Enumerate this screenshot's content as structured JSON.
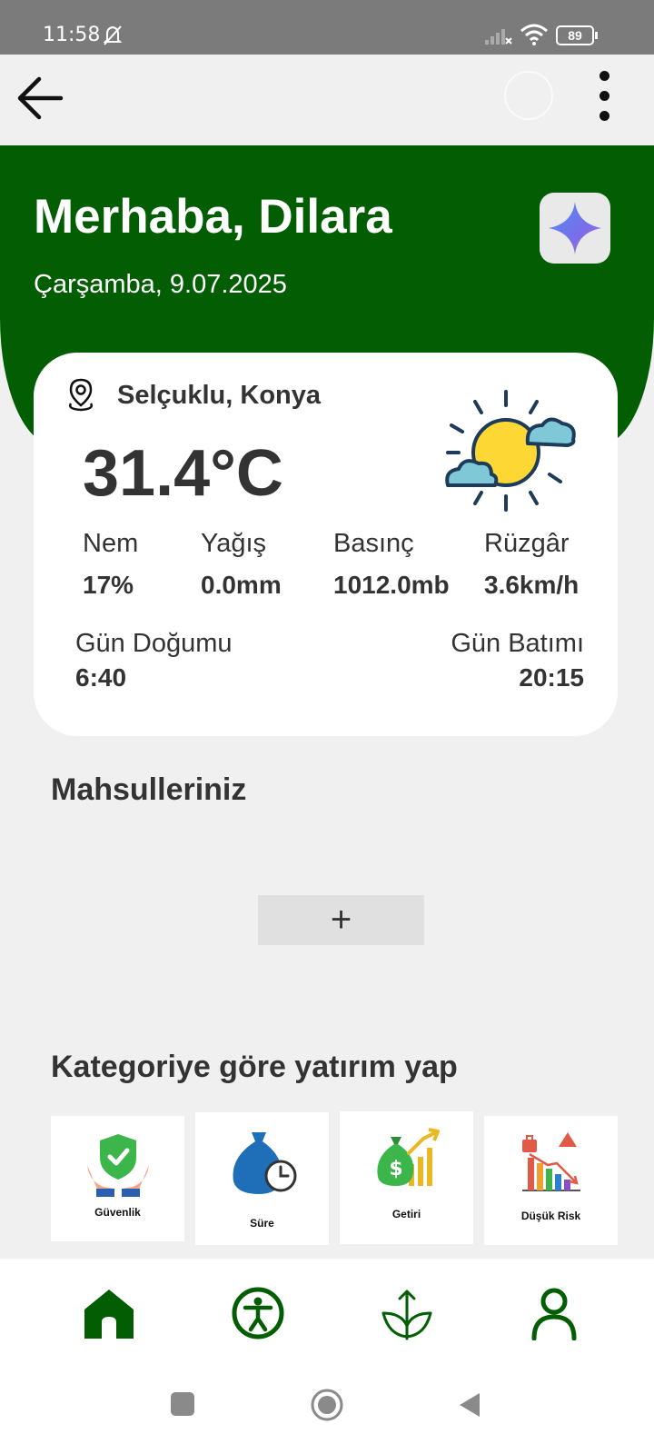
{
  "status_bar": {
    "time": "11:58",
    "battery": "89",
    "icons": [
      "bell-muted-icon",
      "signal-icon",
      "wifi-icon",
      "battery-icon"
    ]
  },
  "app_bar": {
    "back_icon": "arrow-left-icon",
    "menu_icon": "more-vert-icon"
  },
  "header": {
    "greeting": "Merhaba, Dilara",
    "date": "Çarşamba, 9.07.2025",
    "ai_icon": "sparkle-icon"
  },
  "weather": {
    "location": "Selçuklu, Konya",
    "temperature": "31.4°C",
    "condition_icon": "sun-cloud-icon",
    "stats": [
      {
        "label": "Nem",
        "value": "17%"
      },
      {
        "label": "Yağış",
        "value": "0.0mm"
      },
      {
        "label": "Basınç",
        "value": "1012.0mb"
      },
      {
        "label": "Rüzgâr",
        "value": "3.6km/h"
      }
    ],
    "sunrise": {
      "label": "Gün Doğumu",
      "value": "6:40"
    },
    "sunset": {
      "label": "Gün Batımı",
      "value": "20:15"
    }
  },
  "crops": {
    "title": "Mahsulleriniz",
    "add_label": "+"
  },
  "categories": {
    "title": "Kategoriye göre yatırım yap",
    "items": [
      {
        "label": "Güvenlik",
        "icon": "hands-shield-icon"
      },
      {
        "label": "Süre",
        "icon": "money-bag-clock-icon"
      },
      {
        "label": "Getiri",
        "icon": "money-growth-icon"
      },
      {
        "label": "Düşük Risk",
        "icon": "declining-chart-icon"
      }
    ]
  },
  "bottom_nav": {
    "items": [
      {
        "name": "home",
        "icon": "home-icon"
      },
      {
        "name": "accessibility",
        "icon": "accessibility-icon"
      },
      {
        "name": "crops",
        "icon": "sprout-icon"
      },
      {
        "name": "profile",
        "icon": "person-icon"
      }
    ],
    "active_color": "#035d03"
  },
  "colors": {
    "primary_green": "#035d03",
    "background": "#f0f0f0",
    "card": "#ffffff"
  }
}
